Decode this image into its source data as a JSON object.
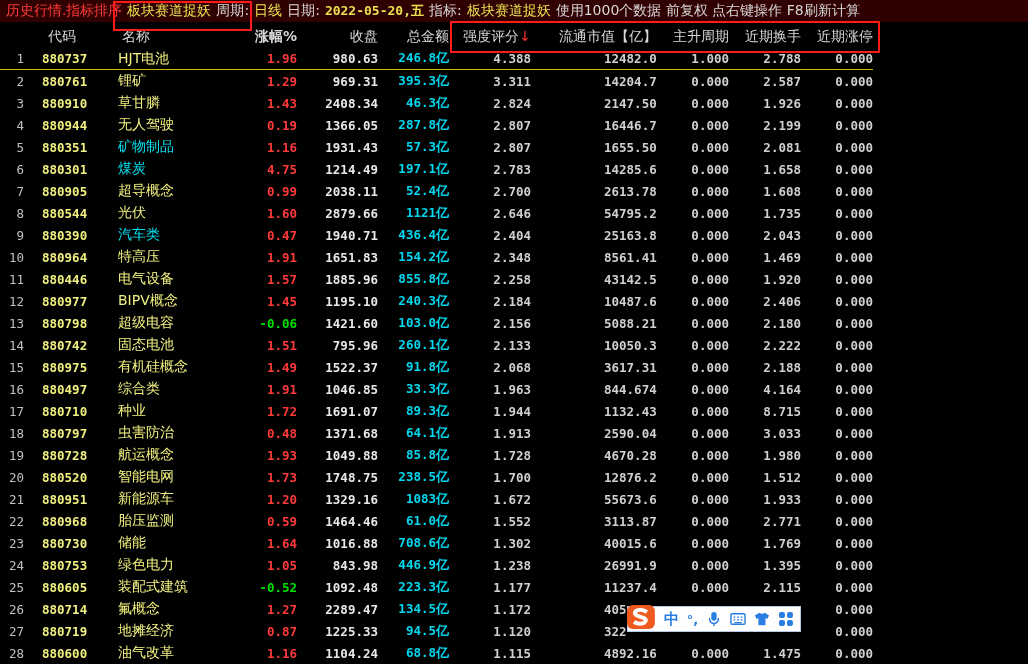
{
  "title_bar": [
    {
      "kind": "title",
      "text": "历史行情.指标排序"
    },
    {
      "kind": "value",
      "text": "板块赛道捉妖"
    },
    {
      "kind": "label",
      "text": "周期:"
    },
    {
      "kind": "value",
      "text": "日线"
    },
    {
      "kind": "label",
      "text": "日期:"
    },
    {
      "kind": "date",
      "text": "2022-05-20,五"
    },
    {
      "kind": "label",
      "text": "指标:"
    },
    {
      "kind": "value",
      "text": "板块赛道捉妖"
    },
    {
      "kind": "label",
      "text": "使用1000个数据 前复权 点右键操作 F8刷新计算"
    }
  ],
  "columns": [
    {
      "label": "代码"
    },
    {
      "label": "名称"
    },
    {
      "label": "涨幅%"
    },
    {
      "label": "收盘"
    },
    {
      "label": "总金额"
    },
    {
      "label": "强度评分",
      "sort_mark": "↓"
    },
    {
      "label": "流通市值【亿】"
    },
    {
      "label": "主升周期"
    },
    {
      "label": "近期换手"
    },
    {
      "label": "近期涨停"
    }
  ],
  "rows": [
    {
      "index": "1",
      "code": "880737",
      "name": "HJT电池",
      "color": "#f0f080",
      "change": "1.96",
      "rising": true,
      "close": "980.63",
      "amount": "246.8亿",
      "score": "4.388",
      "mktcap": "12482.0",
      "period": "1.000",
      "turnover": "2.788",
      "limit": "0.000"
    },
    {
      "index": "2",
      "code": "880761",
      "name": "锂矿",
      "color": "#f0f080",
      "change": "1.29",
      "rising": true,
      "close": "969.31",
      "amount": "395.3亿",
      "score": "3.311",
      "mktcap": "14204.7",
      "period": "0.000",
      "turnover": "2.587",
      "limit": "0.000"
    },
    {
      "index": "3",
      "code": "880910",
      "name": "草甘膦",
      "color": "#f0f080",
      "change": "1.43",
      "rising": true,
      "close": "2408.34",
      "amount": "46.3亿",
      "score": "2.824",
      "mktcap": "2147.50",
      "period": "0.000",
      "turnover": "1.926",
      "limit": "0.000"
    },
    {
      "index": "4",
      "code": "880944",
      "name": "无人驾驶",
      "color": "#f0f080",
      "change": "0.19",
      "rising": true,
      "close": "1366.05",
      "amount": "287.8亿",
      "score": "2.807",
      "mktcap": "16446.7",
      "period": "0.000",
      "turnover": "2.199",
      "limit": "0.000"
    },
    {
      "index": "5",
      "code": "880351",
      "name": "矿物制品",
      "color": "#00e0f0",
      "change": "1.16",
      "rising": true,
      "close": "1931.43",
      "amount": "57.3亿",
      "score": "2.807",
      "mktcap": "1655.50",
      "period": "0.000",
      "turnover": "2.081",
      "limit": "0.000"
    },
    {
      "index": "6",
      "code": "880301",
      "name": "煤炭",
      "color": "#00e0f0",
      "change": "4.75",
      "rising": true,
      "close": "1214.49",
      "amount": "197.1亿",
      "score": "2.783",
      "mktcap": "14285.6",
      "period": "0.000",
      "turnover": "1.658",
      "limit": "0.000"
    },
    {
      "index": "7",
      "code": "880905",
      "name": "超导概念",
      "color": "#f0f080",
      "change": "0.99",
      "rising": true,
      "close": "2038.11",
      "amount": "52.4亿",
      "score": "2.700",
      "mktcap": "2613.78",
      "period": "0.000",
      "turnover": "1.608",
      "limit": "0.000"
    },
    {
      "index": "8",
      "code": "880544",
      "name": "光伏",
      "color": "#f0f080",
      "change": "1.60",
      "rising": true,
      "close": "2879.66",
      "amount": "1121亿",
      "score": "2.646",
      "mktcap": "54795.2",
      "period": "0.000",
      "turnover": "1.735",
      "limit": "0.000"
    },
    {
      "index": "9",
      "code": "880390",
      "name": "汽车类",
      "color": "#00e0f0",
      "change": "0.47",
      "rising": true,
      "close": "1940.71",
      "amount": "436.4亿",
      "score": "2.404",
      "mktcap": "25163.8",
      "period": "0.000",
      "turnover": "2.043",
      "limit": "0.000"
    },
    {
      "index": "10",
      "code": "880964",
      "name": "特高压",
      "color": "#f0f080",
      "change": "1.91",
      "rising": true,
      "close": "1651.83",
      "amount": "154.2亿",
      "score": "2.348",
      "mktcap": "8561.41",
      "period": "0.000",
      "turnover": "1.469",
      "limit": "0.000"
    },
    {
      "index": "11",
      "code": "880446",
      "name": "电气设备",
      "color": "#f0f080",
      "change": "1.57",
      "rising": true,
      "close": "1885.96",
      "amount": "855.8亿",
      "score": "2.258",
      "mktcap": "43142.5",
      "period": "0.000",
      "turnover": "1.920",
      "limit": "0.000"
    },
    {
      "index": "12",
      "code": "880977",
      "name": "BIPV概念",
      "color": "#f0f080",
      "change": "1.45",
      "rising": true,
      "close": "1195.10",
      "amount": "240.3亿",
      "score": "2.184",
      "mktcap": "10487.6",
      "period": "0.000",
      "turnover": "2.406",
      "limit": "0.000"
    },
    {
      "index": "13",
      "code": "880798",
      "name": "超级电容",
      "color": "#f0f080",
      "change": "-0.06",
      "rising": false,
      "close": "1421.60",
      "amount": "103.0亿",
      "score": "2.156",
      "mktcap": "5088.21",
      "period": "0.000",
      "turnover": "2.180",
      "limit": "0.000"
    },
    {
      "index": "14",
      "code": "880742",
      "name": "固态电池",
      "color": "#f0f080",
      "change": "1.51",
      "rising": true,
      "close": "795.96",
      "amount": "260.1亿",
      "score": "2.133",
      "mktcap": "10050.3",
      "period": "0.000",
      "turnover": "2.222",
      "limit": "0.000"
    },
    {
      "index": "15",
      "code": "880975",
      "name": "有机硅概念",
      "color": "#f0f080",
      "change": "1.49",
      "rising": true,
      "close": "1522.37",
      "amount": "91.8亿",
      "score": "2.068",
      "mktcap": "3617.31",
      "period": "0.000",
      "turnover": "2.188",
      "limit": "0.000"
    },
    {
      "index": "16",
      "code": "880497",
      "name": "综合类",
      "color": "#f0f080",
      "change": "1.91",
      "rising": true,
      "close": "1046.85",
      "amount": "33.3亿",
      "score": "1.963",
      "mktcap": "844.674",
      "period": "0.000",
      "turnover": "4.164",
      "limit": "0.000"
    },
    {
      "index": "17",
      "code": "880710",
      "name": "种业",
      "color": "#f0f080",
      "change": "1.72",
      "rising": true,
      "close": "1691.07",
      "amount": "89.3亿",
      "score": "1.944",
      "mktcap": "1132.43",
      "period": "0.000",
      "turnover": "8.715",
      "limit": "0.000"
    },
    {
      "index": "18",
      "code": "880797",
      "name": "虫害防治",
      "color": "#f0f080",
      "change": "0.48",
      "rising": true,
      "close": "1371.68",
      "amount": "64.1亿",
      "score": "1.913",
      "mktcap": "2590.04",
      "period": "0.000",
      "turnover": "3.033",
      "limit": "0.000"
    },
    {
      "index": "19",
      "code": "880728",
      "name": "航运概念",
      "color": "#f0f080",
      "change": "1.93",
      "rising": true,
      "close": "1049.88",
      "amount": "85.8亿",
      "score": "1.728",
      "mktcap": "4670.28",
      "period": "0.000",
      "turnover": "1.980",
      "limit": "0.000"
    },
    {
      "index": "20",
      "code": "880520",
      "name": "智能电网",
      "color": "#f0f080",
      "change": "1.73",
      "rising": true,
      "close": "1748.75",
      "amount": "238.5亿",
      "score": "1.700",
      "mktcap": "12876.2",
      "period": "0.000",
      "turnover": "1.512",
      "limit": "0.000"
    },
    {
      "index": "21",
      "code": "880951",
      "name": "新能源车",
      "color": "#f0f080",
      "change": "1.20",
      "rising": true,
      "close": "1329.16",
      "amount": "1083亿",
      "score": "1.672",
      "mktcap": "55673.6",
      "period": "0.000",
      "turnover": "1.933",
      "limit": "0.000"
    },
    {
      "index": "22",
      "code": "880968",
      "name": "胎压监测",
      "color": "#f0f080",
      "change": "0.59",
      "rising": true,
      "close": "1464.46",
      "amount": "61.0亿",
      "score": "1.552",
      "mktcap": "3113.87",
      "period": "0.000",
      "turnover": "2.771",
      "limit": "0.000"
    },
    {
      "index": "23",
      "code": "880730",
      "name": "储能",
      "color": "#f0f080",
      "change": "1.64",
      "rising": true,
      "close": "1016.88",
      "amount": "708.6亿",
      "score": "1.302",
      "mktcap": "40015.6",
      "period": "0.000",
      "turnover": "1.769",
      "limit": "0.000"
    },
    {
      "index": "24",
      "code": "880753",
      "name": "绿色电力",
      "color": "#f0f080",
      "change": "1.05",
      "rising": true,
      "close": "843.98",
      "amount": "446.9亿",
      "score": "1.238",
      "mktcap": "26991.9",
      "period": "0.000",
      "turnover": "1.395",
      "limit": "0.000"
    },
    {
      "index": "25",
      "code": "880605",
      "name": "装配式建筑",
      "color": "#f0f080",
      "change": "-0.52",
      "rising": false,
      "close": "1092.48",
      "amount": "223.3亿",
      "score": "1.177",
      "mktcap": "11237.4",
      "period": "0.000",
      "turnover": "2.115",
      "limit": "0.000"
    },
    {
      "index": "26",
      "code": "880714",
      "name": "氟概念",
      "color": "#f0f080",
      "change": "1.27",
      "rising": true,
      "close": "2289.47",
      "amount": "134.5亿",
      "score": "1.172",
      "mktcap": "405",
      "limit": "0.000"
    },
    {
      "index": "27",
      "code": "880719",
      "name": "地摊经济",
      "color": "#f0f080",
      "change": "0.87",
      "rising": true,
      "close": "1225.33",
      "amount": "94.5亿",
      "score": "1.120",
      "mktcap": "322",
      "limit": "0.000"
    },
    {
      "index": "28",
      "code": "880600",
      "name": "油气改革",
      "color": "#f0f080",
      "change": "1.16",
      "rising": true,
      "close": "1104.24",
      "amount": "68.8亿",
      "score": "1.115",
      "mktcap": "4892.16",
      "period": "0.000",
      "turnover": "1.475",
      "limit": "0.000"
    }
  ],
  "ime_toolbar": {
    "mode": "中",
    "punctuation": "°,"
  }
}
